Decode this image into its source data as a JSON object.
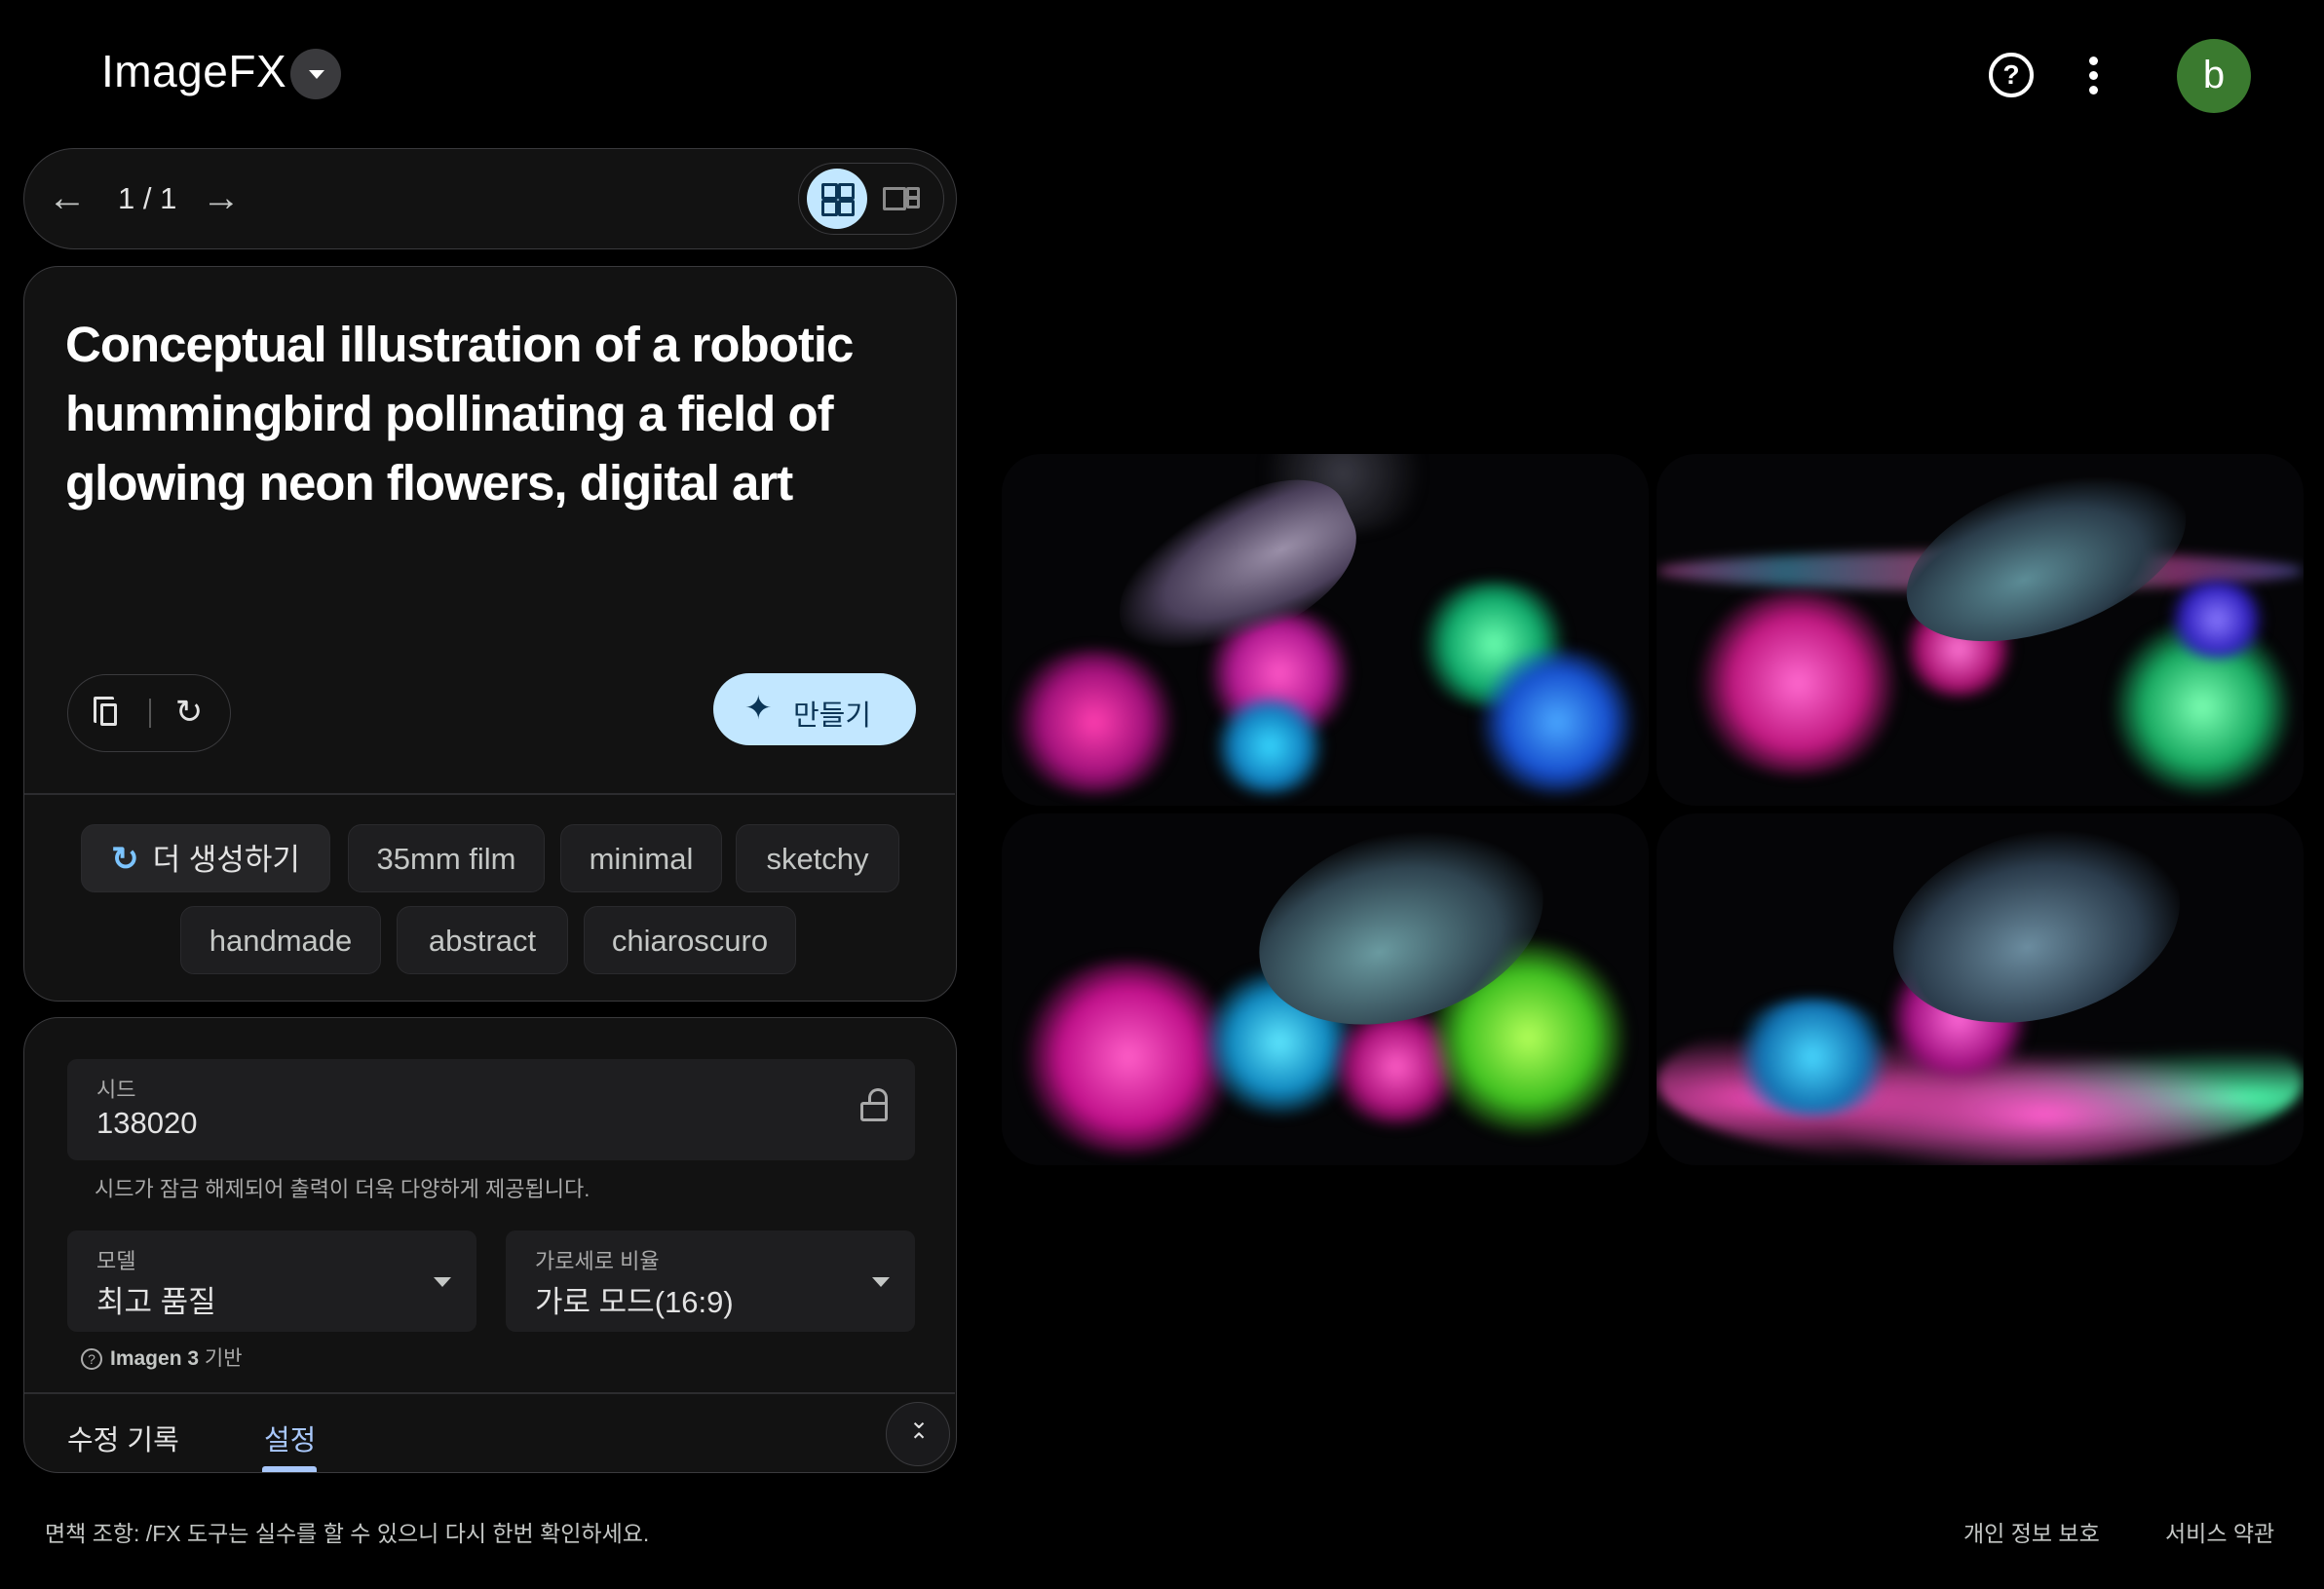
{
  "header": {
    "app_title": "ImageFX",
    "avatar_letter": "b"
  },
  "pager": {
    "count": "1 / 1"
  },
  "prompt": {
    "text": "Conceptual illustration of a robotic hummingbird pollinating a field of glowing neon flowers, digital art",
    "make_label": "만들기"
  },
  "chips": {
    "regenerate": "더 생성하기",
    "items": [
      "35mm film",
      "minimal",
      "sketchy",
      "handmade",
      "abstract",
      "chiaroscuro"
    ]
  },
  "settings": {
    "seed_label": "시드",
    "seed_value": "138020",
    "seed_note": "시드가 잠금 해제되어 출력이 더욱 다양하게 제공됩니다.",
    "model_label": "모델",
    "model_value": "최고 품질",
    "ratio_label": "가로세로 비율",
    "ratio_value": "가로 모드(16:9)",
    "model_note_bold": "Imagen 3",
    "model_note_rest": " 기반",
    "tabs": [
      "수정 기록",
      "설정"
    ],
    "active_tab": "설정"
  },
  "footer": {
    "disclaimer": "면책 조항: /FX 도구는 실수를 할 수 있으니 다시 한번 확인하세요.",
    "privacy": "개인 정보 보호",
    "terms": "서비스 약관"
  },
  "colors": {
    "accent": "#c2e7ff",
    "active_tab": "#a8c7fa",
    "avatar": "#3a7a2f"
  }
}
